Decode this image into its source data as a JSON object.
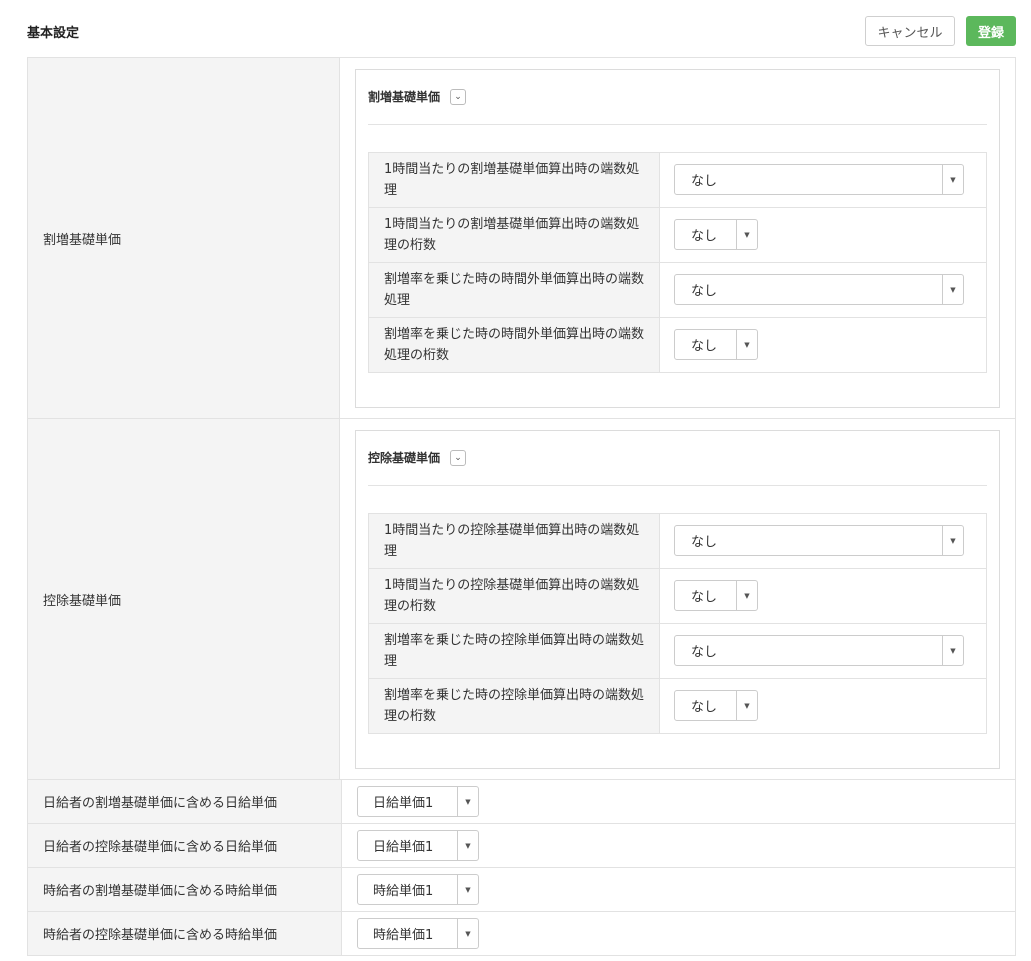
{
  "header": {
    "title": "基本設定",
    "cancel_label": "キャンセル",
    "register_label": "登録"
  },
  "sections": [
    {
      "label": "割増基礎単価",
      "panel_title": "割増基礎単価",
      "collapse_icon": "chevron-down-icon",
      "rows": [
        {
          "label": "1時間当たりの割増基礎単価算出時の端数処理",
          "value": "なし",
          "control": "wide"
        },
        {
          "label": "1時間当たりの割増基礎単価算出時の端数処理の桁数",
          "value": "なし",
          "control": "small"
        },
        {
          "label": "割増率を乗じた時の時間外単価算出時の端数処理",
          "value": "なし",
          "control": "wide"
        },
        {
          "label": "割増率を乗じた時の時間外単価算出時の端数処理の桁数",
          "value": "なし",
          "control": "small"
        }
      ]
    },
    {
      "label": "控除基礎単価",
      "panel_title": "控除基礎単価",
      "collapse_icon": "chevron-down-icon",
      "rows": [
        {
          "label": "1時間当たりの控除基礎単価算出時の端数処理",
          "value": "なし",
          "control": "wide"
        },
        {
          "label": "1時間当たりの控除基礎単価算出時の端数処理の桁数",
          "value": "なし",
          "control": "small"
        },
        {
          "label": "割増率を乗じた時の控除単価算出時の端数処理",
          "value": "なし",
          "control": "wide"
        },
        {
          "label": "割増率を乗じた時の控除単価算出時の端数処理の桁数",
          "value": "なし",
          "control": "small"
        }
      ]
    }
  ],
  "simple_rows": [
    {
      "label": "日給者の割増基礎単価に含める日給単価",
      "value": "日給単価1"
    },
    {
      "label": "日給者の控除基礎単価に含める日給単価",
      "value": "日給単価1"
    },
    {
      "label": "時給者の割増基礎単価に含める時給単価",
      "value": "時給単価1"
    },
    {
      "label": "時給者の控除基礎単価に含める時給単価",
      "value": "時給単価1"
    }
  ],
  "colors": {
    "register_button": "#5cb85c",
    "label_background": "#f4f4f4",
    "border": "#e2e2e2"
  }
}
